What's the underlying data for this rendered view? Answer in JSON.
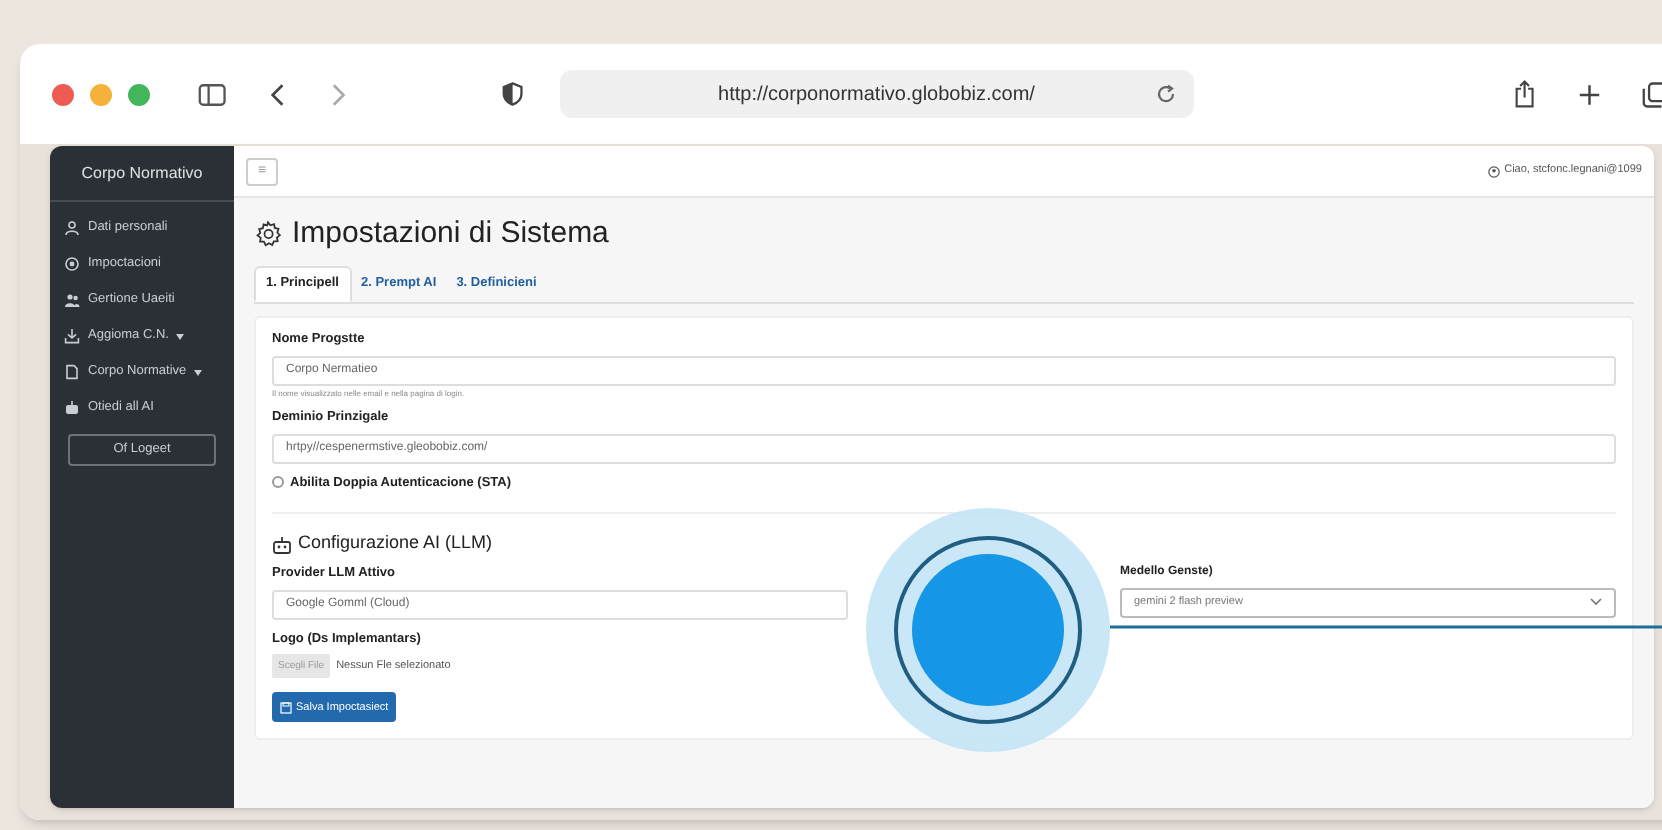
{
  "browser": {
    "url": "http://corponormativo.globobiz.com/"
  },
  "sidebar": {
    "title": "Corpo Normativo",
    "items": [
      {
        "label": "Dati personali",
        "dropdown": false
      },
      {
        "label": "Impoctacioni",
        "dropdown": false
      },
      {
        "label": "Gertione Uaeiti",
        "dropdown": false
      },
      {
        "label": "Aggioma C.N.",
        "dropdown": true
      },
      {
        "label": "Corpo Normative",
        "dropdown": true
      },
      {
        "label": "Otiedi all AI",
        "dropdown": false
      }
    ],
    "logout": "Of Logeet"
  },
  "topbar": {
    "menu_glyph": "≡",
    "user": "Ciao, stcfonc.legnani@1099"
  },
  "page": {
    "title": "Impostazioni di Sistema"
  },
  "tabs": [
    {
      "label": "1. Principell",
      "selected": true
    },
    {
      "label": "2. Prempt AI",
      "selected": false
    },
    {
      "label": "3. Definicieni",
      "selected": false
    }
  ],
  "form": {
    "project_label": "Nome Progstte",
    "project_value": "Corpo Nermatieo",
    "project_help": "Il nome visualizzato nelle email e nella pagina di login.",
    "domain_label": "Deminio Prinzigale",
    "domain_value": "hrtpy//cespenermstive.gleobobiz.com/",
    "twofa_label": "Abilita Doppia Autenticacione (STA)",
    "twofa_checked": false,
    "ai_section": "Configurazione AI (LLM)",
    "provider_label": "Provider LLM Attivo",
    "provider_value": "Google Gomml (Cloud)",
    "model_label": "Medello Genste)",
    "model_value": "gemini 2 flash preview",
    "logo_label": "Logo (Ds Implemantars)",
    "file_button": "Scegli File",
    "file_status": "Nessun Fle selezionato",
    "save": "Salva Impoctasiect"
  }
}
